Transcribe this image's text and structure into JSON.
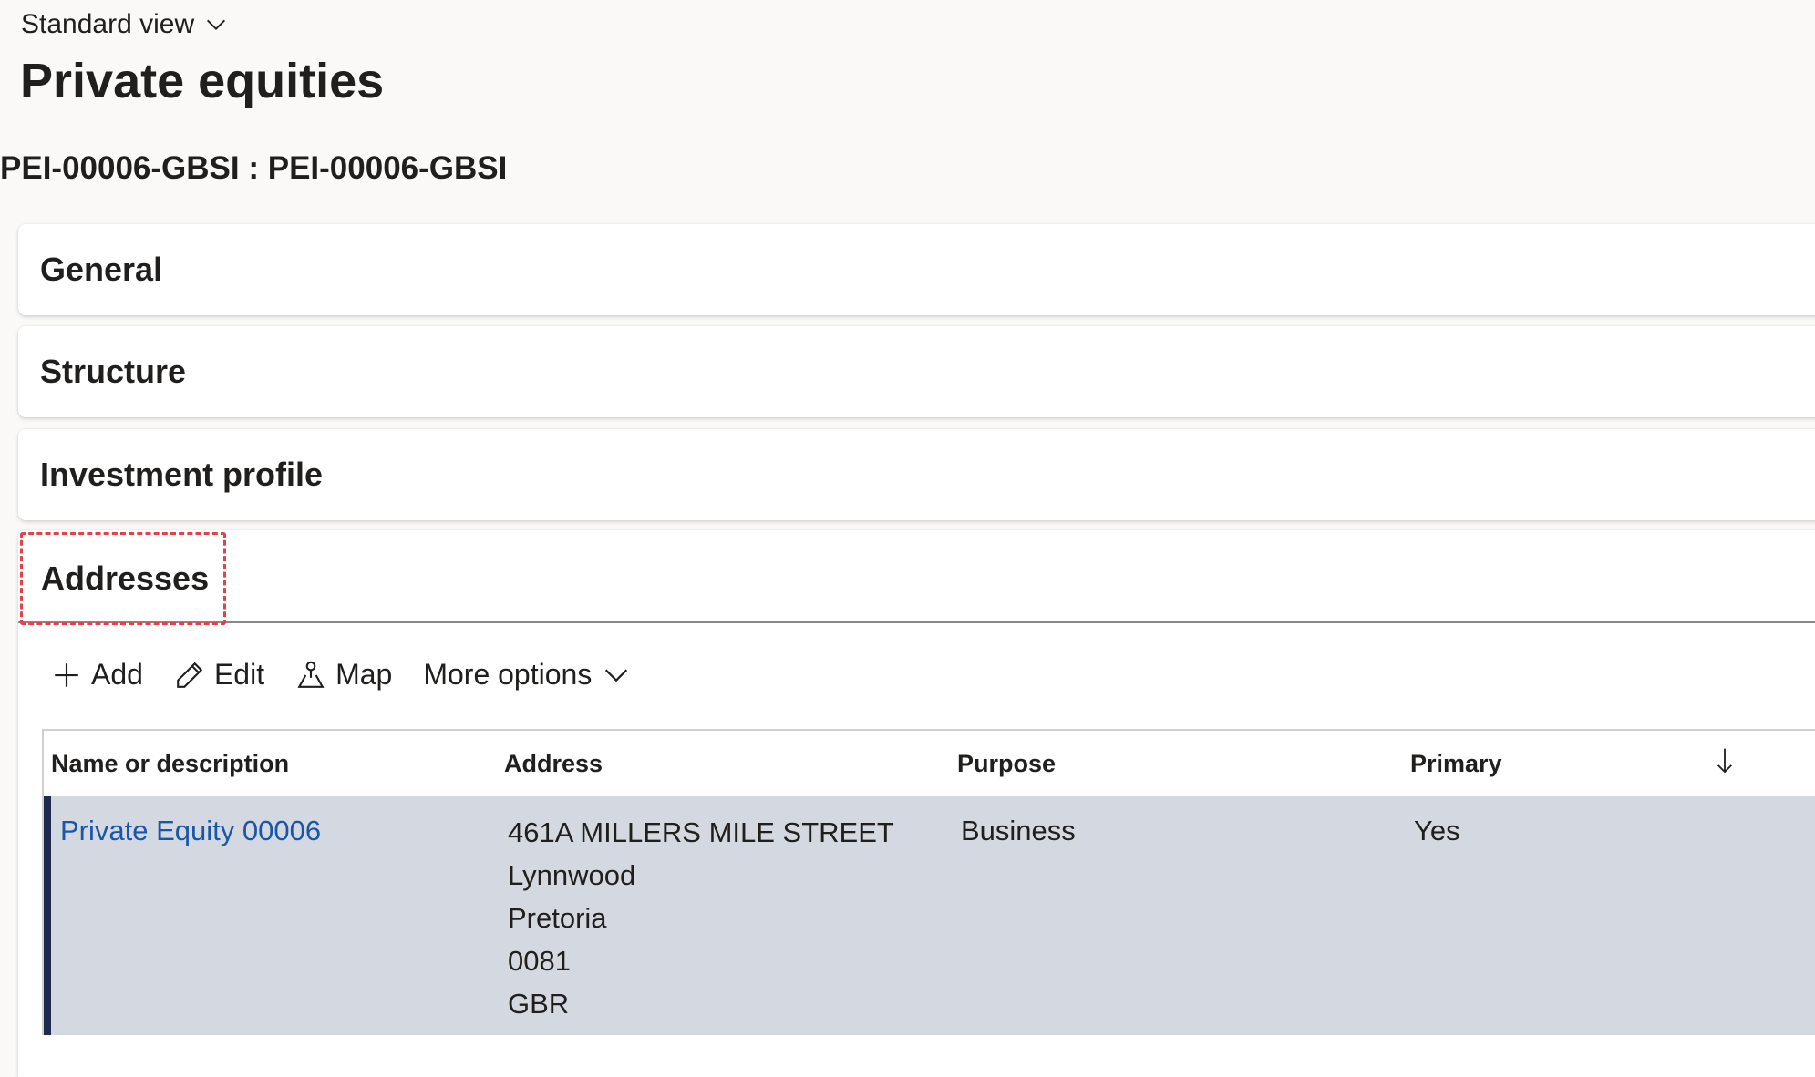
{
  "view_selector": {
    "label": "Standard view",
    "icon": "chevron-down-icon"
  },
  "page": {
    "title": "Private equities",
    "record_id": "PEI-00006-GBSI : PEI-00006-GBSI"
  },
  "fasttabs": [
    {
      "label": "General"
    },
    {
      "label": "Structure"
    },
    {
      "label": "Investment profile"
    },
    {
      "label": "Addresses"
    }
  ],
  "toolbar": {
    "add_label": "Add",
    "edit_label": "Edit",
    "map_label": "Map",
    "more_label": "More options"
  },
  "grid": {
    "columns": [
      "Name or description",
      "Address",
      "Purpose",
      "Primary"
    ],
    "rows": [
      {
        "name": "Private Equity 00006",
        "address_lines": [
          "461A MILLERS MILE STREET",
          "Lynnwood",
          "Pretoria",
          "0081",
          "GBR"
        ],
        "purpose": "Business",
        "primary": "Yes"
      }
    ]
  },
  "colors": {
    "link": "#1a56a8",
    "selected_row_bg": "#d3d8e1",
    "selected_row_marker": "#1f2a4e",
    "highlight_box": "#e0434c"
  }
}
